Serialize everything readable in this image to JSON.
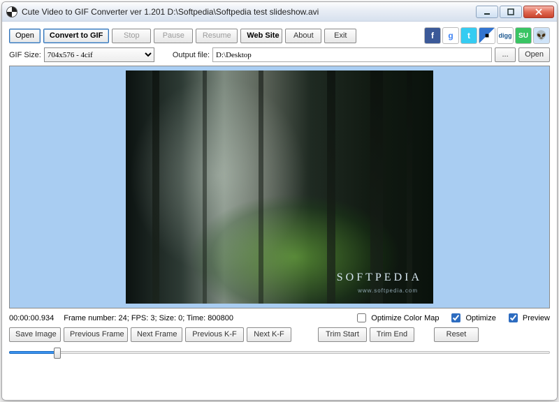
{
  "title": "Cute Video to GIF Converter ver 1.201   D:\\Softpedia\\Softpedia test slideshow.avi",
  "toolbar": {
    "open": "Open",
    "convert": "Convert to GIF",
    "stop": "Stop",
    "pause": "Pause",
    "resume": "Resume",
    "website": "Web Site",
    "about": "About",
    "exit": "Exit"
  },
  "social": {
    "facebook": "f",
    "google": "g",
    "twitter": "t",
    "delicious": "■",
    "digg": "digg",
    "stumble": "SU",
    "reddit": "👽"
  },
  "size_row": {
    "label": "GIF Size:",
    "selected": "704x576 - 4cif",
    "output_label": "Output file:",
    "output_value": "D:\\Desktop",
    "browse": "...",
    "open": "Open"
  },
  "preview": {
    "watermark": "SOFTPEDIA",
    "watermark_sub": "www.softpedia.com"
  },
  "info": {
    "time": "00:00:00.934",
    "frame_text": "Frame number: 24; FPS: 3; Size: 0; Time: 800800",
    "opt_colormap": "Optimize Color Map",
    "opt_colormap_checked": false,
    "optimize": "Optimize",
    "optimize_checked": true,
    "preview": "Preview",
    "preview_checked": true
  },
  "controls": {
    "save_image": "Save Image",
    "prev_frame": "Previous Frame",
    "next_frame": "Next Frame",
    "prev_kf": "Previous K-F",
    "next_kf": "Next K-F",
    "trim_start": "Trim Start",
    "trim_end": "Trim End",
    "reset": "Reset"
  }
}
